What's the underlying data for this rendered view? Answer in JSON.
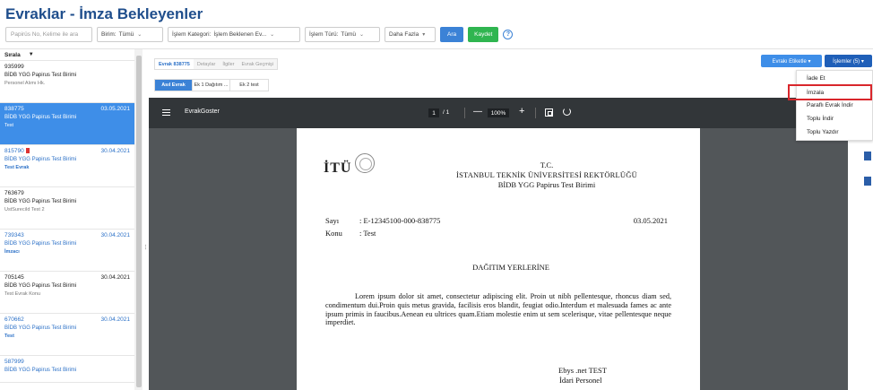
{
  "header": {
    "title": "Evraklar - İmza Bekleyenler",
    "search_placeholder": "Papirüs No, Kelime ile ara",
    "birim_label": "Birim:",
    "birim_value": "Tümü",
    "kategori_label": "İşlem Kategori:",
    "kategori_value": "İşlem Beklenen Ev...",
    "tur_label": "İşlem Türü:",
    "tur_value": "Tümü",
    "more_label": "Daha Fazla",
    "search_button": "Ara",
    "save_button": "Kaydet",
    "help_glyph": "?"
  },
  "list": {
    "sort_label": "Sırala",
    "items": [
      {
        "num": "935999",
        "unit": "BİDB YGG Papirus Test Birimi",
        "sub": "Personel Alımı Hk.",
        "date": "",
        "style": "plain"
      },
      {
        "num": "838775",
        "unit": "BİDB YGG Papirus Test Birimi",
        "sub": "Test",
        "date": "03.05.2021",
        "style": "active"
      },
      {
        "num": "815790",
        "unit": "BİDB YGG Papirus Test Birimi",
        "sub": "Test Evrak",
        "date": "30.04.2021",
        "style": "blue",
        "flag": true
      },
      {
        "num": "763679",
        "unit": "BİDB YGG Papirus Test Birimi",
        "sub": "UstSureciId Test 2",
        "date": "",
        "style": "plain"
      },
      {
        "num": "739343",
        "unit": "BİDB YGG Papirus Test Birimi",
        "sub": "İmzacı",
        "date": "30.04.2021",
        "style": "blue"
      },
      {
        "num": "705145",
        "unit": "BİDB YGG Papirus Test Birimi",
        "sub": "Test Evrak Konu",
        "date": "30.04.2021",
        "style": "plain"
      },
      {
        "num": "670662",
        "unit": "BİDB YGG Papirus Test Birimi",
        "sub": "Test",
        "date": "30.04.2021",
        "style": "blue"
      },
      {
        "num": "587999",
        "unit": "BİDB YGG Papirus Test Birimi",
        "sub": "",
        "date": "",
        "style": "blue"
      }
    ]
  },
  "tabs_top": [
    "Evrak 838775",
    "Detaylar",
    "İlgiler",
    "Evrak Geçmişi"
  ],
  "tabs_doc": [
    "Asıl Evrak",
    "Ek 1 Dağıtım ...",
    "Ek 2 test"
  ],
  "actions": {
    "etiket": "Evrakı Etiketle ▾",
    "islemler": "İşlemler (5) ▾"
  },
  "dropdown": [
    "İade Et",
    "İmzala",
    "Paraflı Evrak İndir",
    "Toplu İndir",
    "Toplu Yazdır"
  ],
  "viewer": {
    "title": "EvrakGoster",
    "page": "1",
    "page_total": "/ 1",
    "zoom": "100%",
    "zoom_minus": "—",
    "zoom_plus": "+"
  },
  "document": {
    "logo": "İTÜ",
    "header1": "T.C.",
    "header2": "İSTANBUL TEKNİK ÜNİVERSİTESİ REKTÖRLÜĞÜ",
    "header3": "BİDB YGG Papirus Test Birimi",
    "sayi_label": "Sayı",
    "sayi_value": ": E-12345100-000-838775",
    "konu_label": "Konu",
    "konu_value": ": Test",
    "date": "03.05.2021",
    "distribution": "DAĞITIM YERLERİNE",
    "body": "Lorem ipsum dolor sit amet, consectetur adipiscing elit. Proin ut nibh pellentesque, rhoncus diam sed, condimentum dui.Proin quis metus gravida, facilisis eros blandit, feugiat odio.Interdum et malesuada fames ac ante ipsum primis in faucibus.Aenean eu ultrices quam.Etiam molestie enim ut sem scelerisque, vitae pellentesque neque imperdiet.",
    "signer": "Ebys .net TEST",
    "signer_title": "İdari Personel"
  },
  "colors": {
    "title": "#1f4e8c",
    "primary": "#3b82d6",
    "active_item": "#3e8ee8",
    "success": "#2fb550",
    "highlight": "#d9262b"
  }
}
